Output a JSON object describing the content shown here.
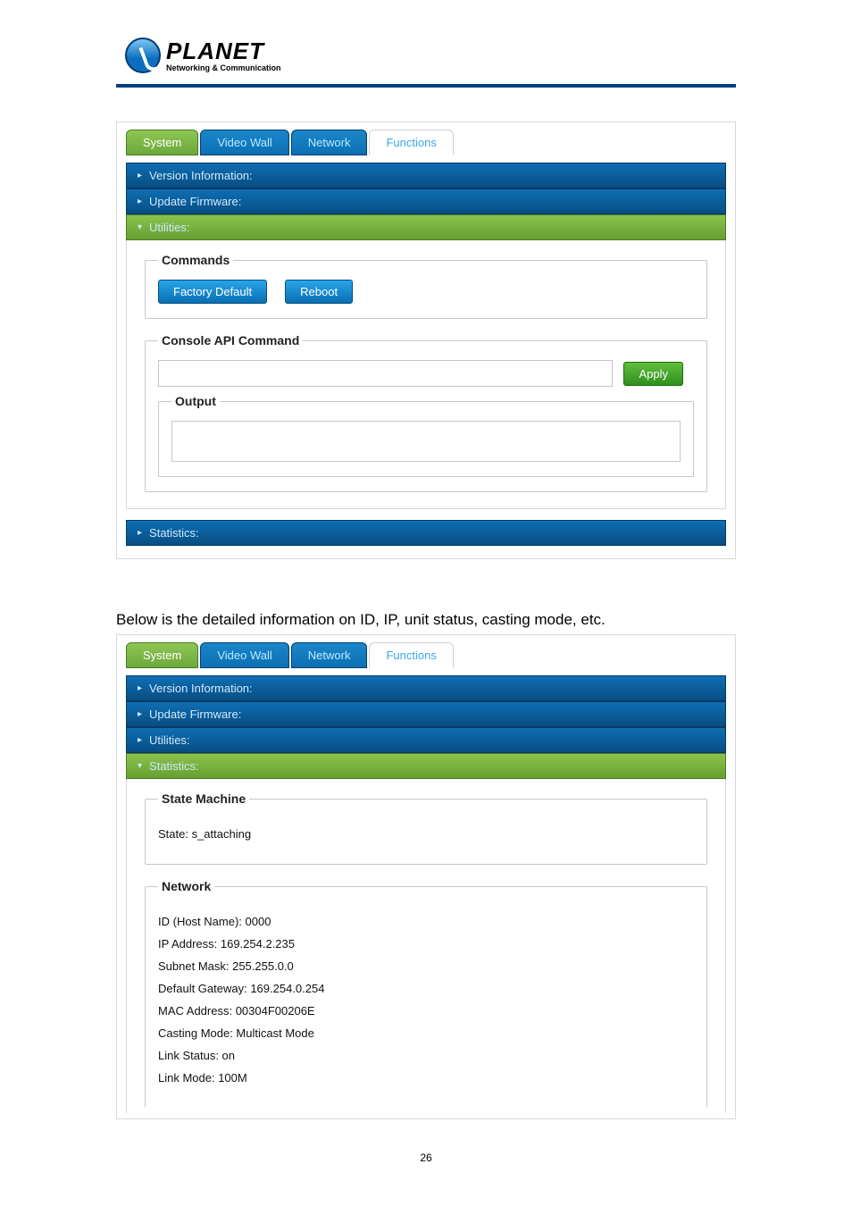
{
  "logo": {
    "brand": "PLANET",
    "tagline": "Networking & Communication"
  },
  "tabs": {
    "system": "System",
    "videoWall": "Video Wall",
    "network": "Network",
    "functions": "Functions"
  },
  "acc": {
    "versionInfo": "Version Information:",
    "updateFirmware": "Update Firmware:",
    "utilities": "Utilities:",
    "statistics": "Statistics:"
  },
  "screenshot1": {
    "commandsLegend": "Commands",
    "factoryDefault": "Factory Default",
    "reboot": "Reboot",
    "consoleApiLegend": "Console API Command",
    "apply": "Apply",
    "outputLegend": "Output"
  },
  "caption": "Below is the detailed information on ID, IP, unit status, casting mode, etc.",
  "screenshot2": {
    "stateMachineLegend": "State Machine",
    "state": "State: s_attaching",
    "networkLegend": "Network",
    "id": "ID (Host Name): 0000",
    "ip": "IP Address: 169.254.2.235",
    "subnet": "Subnet Mask: 255.255.0.0",
    "gateway": "Default Gateway: 169.254.0.254",
    "mac": "MAC Address:  00304F00206E",
    "casting": "Casting Mode: Multicast Mode",
    "linkStatus": "Link Status: on",
    "linkMode": "Link Mode: 100M"
  },
  "pageNumber": "26"
}
